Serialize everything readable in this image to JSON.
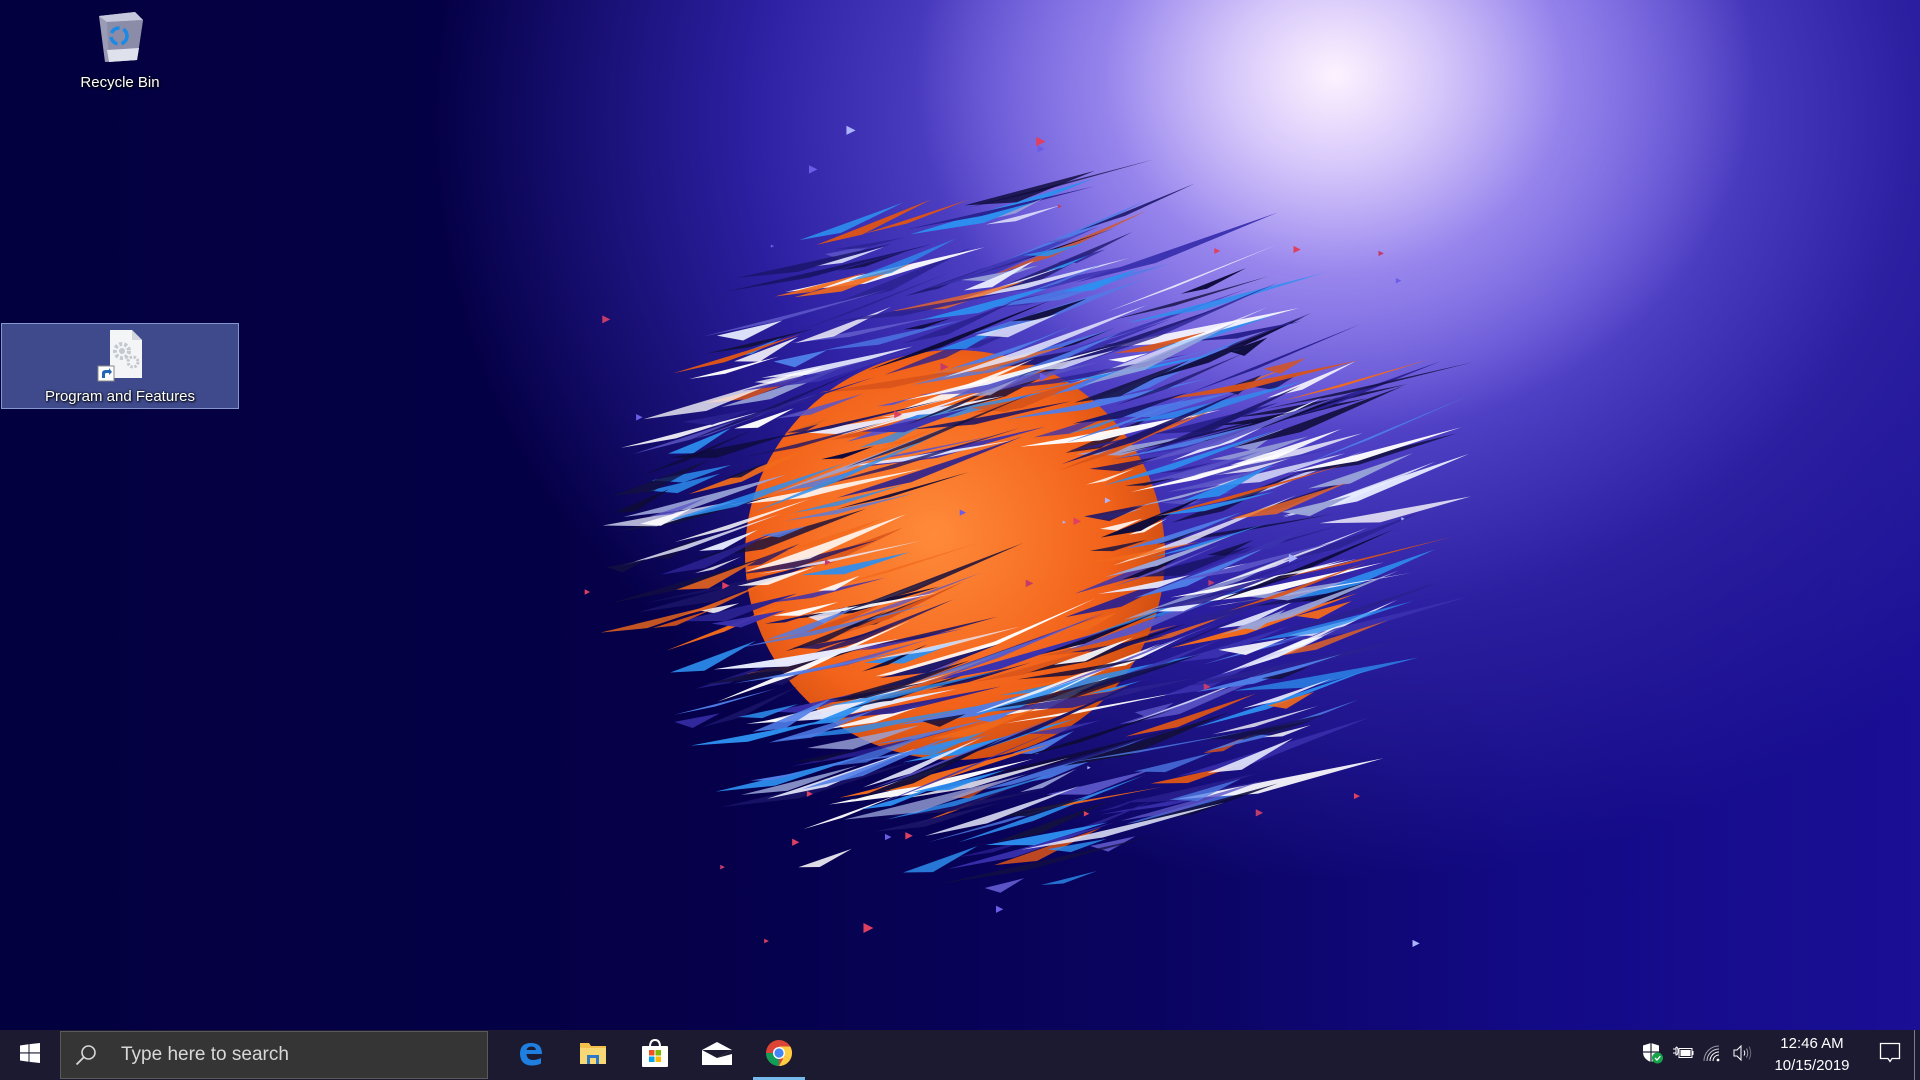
{
  "desktop": {
    "icons": [
      {
        "label": "Recycle Bin",
        "icon": "recycle-bin-icon",
        "selected": false
      },
      {
        "label": "Program and Features",
        "icon": "settings-file-shortcut-icon",
        "selected": true
      }
    ],
    "wallpaper": {
      "description": "Abstract shattered orange sphere on purple gradient",
      "colors": {
        "background_dark": "#05004a",
        "glow": "#f6ecff",
        "sphere": "#f26a1b"
      }
    }
  },
  "taskbar": {
    "start_icon": "windows-logo-icon",
    "search": {
      "placeholder": "Type here to search",
      "icon": "search-icon"
    },
    "pinned_apps": [
      {
        "name": "Microsoft Edge",
        "icon": "edge-icon",
        "active": false
      },
      {
        "name": "File Explorer",
        "icon": "file-explorer-icon",
        "active": false
      },
      {
        "name": "Microsoft Store",
        "icon": "store-icon",
        "active": false
      },
      {
        "name": "Mail",
        "icon": "mail-icon",
        "active": false
      },
      {
        "name": "Google Chrome",
        "icon": "chrome-icon",
        "active": true
      }
    ],
    "tray": {
      "icons": [
        "windows-security-icon",
        "battery-charging-icon",
        "wifi-icon",
        "volume-icon"
      ],
      "time": "12:46 AM",
      "date": "10/15/2019",
      "notification_icon": "action-center-icon"
    },
    "colors": {
      "background": "#1c1a30",
      "search_bg": "#353535",
      "active_indicator": "#76b9ed"
    }
  }
}
